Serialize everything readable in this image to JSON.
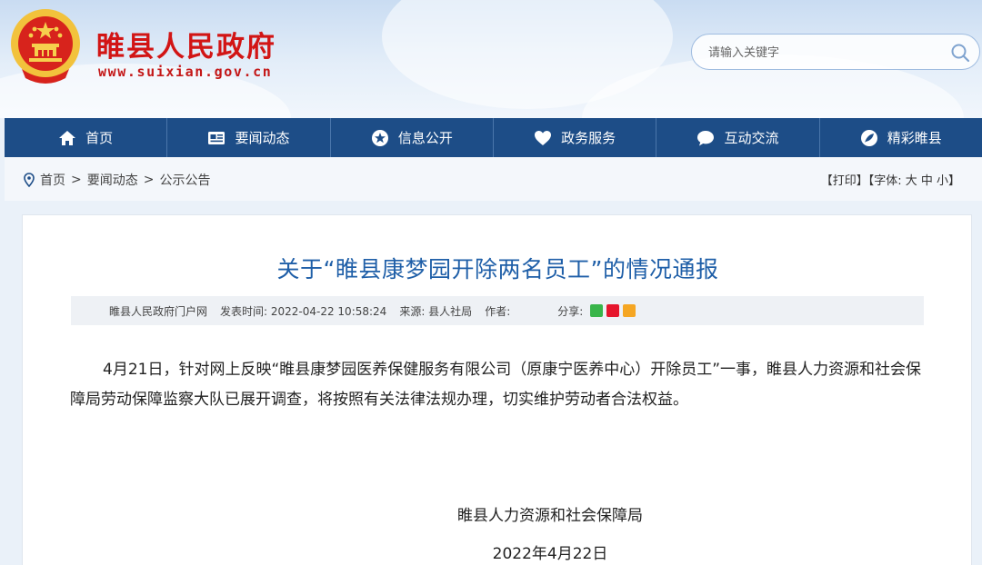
{
  "header": {
    "site_name": "睢县人民政府",
    "site_url": "www.suixian.gov.cn",
    "search_placeholder": "请输入关键字"
  },
  "nav": {
    "items": [
      {
        "label": "首页",
        "icon": "home-icon"
      },
      {
        "label": "要闻动态",
        "icon": "news-icon"
      },
      {
        "label": "信息公开",
        "icon": "star-icon"
      },
      {
        "label": "政务服务",
        "icon": "heart-icon"
      },
      {
        "label": "互动交流",
        "icon": "chat-icon"
      },
      {
        "label": "精彩睢县",
        "icon": "feather-icon"
      }
    ]
  },
  "breadcrumb": {
    "items": [
      "首页",
      "要闻动态",
      "公示公告"
    ],
    "separator": ">"
  },
  "tools": "【打印】【字体: 大 中 小】",
  "article": {
    "title": "关于“睢县康梦园开除两名员工”的情况通报",
    "meta": {
      "site": "睢县人民政府门户网",
      "published": "发表时间: 2022-04-22 10:58:24",
      "source": "来源: 县人社局",
      "author": "作者:",
      "share_label": "分享:"
    },
    "body": "4月21日，针对网上反映“睢县康梦园医养保健服务有限公司（原康宁医养中心）开除员工”一事，睢县人力资源和社会保障局劳动保障监察大队已展开调查，将按照有关法律法规办理，切实维护劳动者合法权益。",
    "signature": "睢县人力资源和社会保障局",
    "date": "2022年4月22日"
  },
  "colors": {
    "nav_bg": "#1d4d87",
    "title": "#1f5fa8",
    "site_name": "#d21515"
  }
}
